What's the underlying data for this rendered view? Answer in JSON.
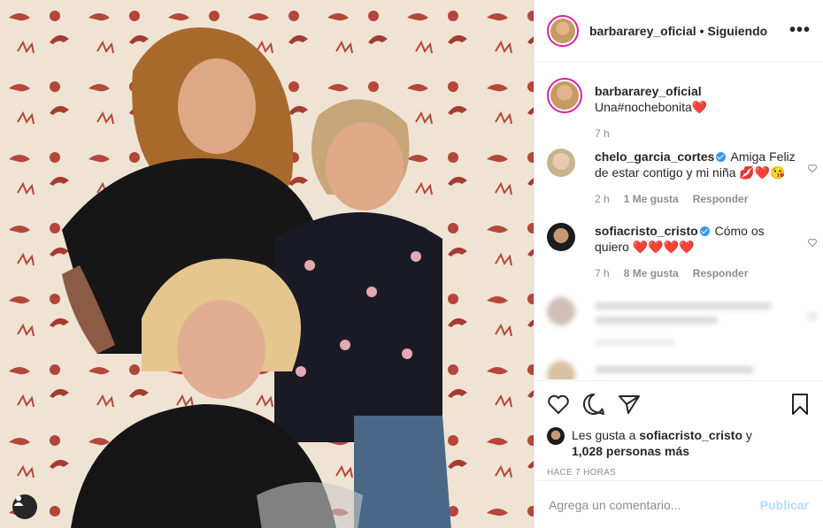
{
  "post": {
    "username": "barbararey_oficial",
    "following_label": "Siguiendo",
    "more_icon": "more-options-icon"
  },
  "caption": {
    "username": "barbararey_oficial",
    "text": "Una#nochebonita",
    "emoji": "❤️",
    "time": "7 h"
  },
  "comments": [
    {
      "username": "chelo_garcia_cortes",
      "verified": true,
      "text": "Amiga Feliz de estar contigo y mi niña",
      "emojis": "💋❤️😘",
      "time": "2 h",
      "likes": "1 Me gusta",
      "reply": "Responder"
    },
    {
      "username": "sofiacristo_cristo",
      "verified": true,
      "text": "Cómo os quiero",
      "emojis": "❤️❤️❤️❤️",
      "time": "7 h",
      "likes": "8 Me gusta",
      "reply": "Responder"
    }
  ],
  "likes": {
    "prefix": "Les gusta a",
    "username": "sofiacristo_cristo",
    "middle": "y",
    "count": "1,028 personas más"
  },
  "posted_ago": "HACE 7 HORAS",
  "comment_box": {
    "placeholder": "Agrega un comentario...",
    "publish_label": "Publicar"
  },
  "colors": {
    "accent_blue": "#3897f0",
    "publish_disabled": "#b3dbff",
    "muted": "#8e8e8e",
    "story_ring": "#d6249f"
  }
}
